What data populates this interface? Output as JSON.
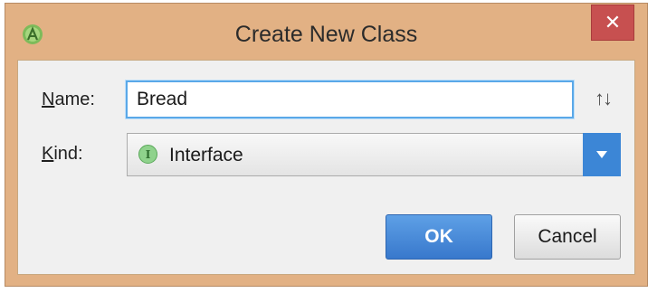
{
  "window": {
    "title": "Create New Class",
    "close_label": "✕",
    "app_icon": "android-studio-icon"
  },
  "form": {
    "name_label_accel": "N",
    "name_label_rest": "ame:",
    "name_value": "Bread",
    "kind_label_accel": "K",
    "kind_label_rest": "ind:",
    "kind_value": "Interface",
    "kind_badge": "I",
    "sort_icon": "↑↓"
  },
  "buttons": {
    "ok_label": "OK",
    "cancel_label": "Cancel"
  },
  "colors": {
    "frame": "#e2b184",
    "close": "#c75050",
    "accent": "#3c86d6",
    "interface_badge": "#8fd28c"
  }
}
